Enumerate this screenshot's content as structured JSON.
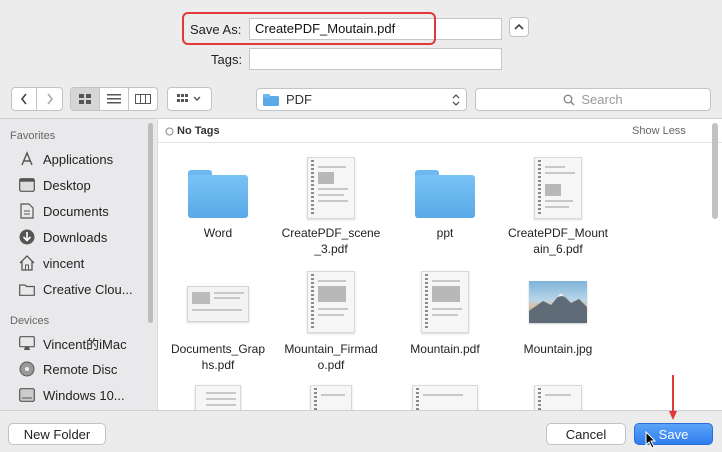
{
  "header": {
    "save_as_label": "Save As:",
    "save_as_value": "CreatePDF_Moutain.pdf",
    "tags_label": "Tags:",
    "tags_value": ""
  },
  "toolbar": {
    "location": "PDF",
    "search_placeholder": "Search"
  },
  "sidebar": {
    "favorites_heading": "Favorites",
    "favorites": [
      "Applications",
      "Desktop",
      "Documents",
      "Downloads",
      "vincent",
      "Creative Clou..."
    ],
    "devices_heading": "Devices",
    "devices": [
      "Vincent的iMac",
      "Remote Disc",
      "Windows 10..."
    ]
  },
  "browser": {
    "tag_label": "No Tags",
    "show_less": "Show Less",
    "items": [
      {
        "name": "Word",
        "kind": "folder"
      },
      {
        "name": "CreatePDF_scene_3.pdf",
        "kind": "pdf"
      },
      {
        "name": "ppt",
        "kind": "folder"
      },
      {
        "name": "CreatePDF_Mountain_6.pdf",
        "kind": "pdf"
      },
      {
        "name": "Documents_Graphs.pdf",
        "kind": "wide-pdf"
      },
      {
        "name": "Mountain_Firmado.pdf",
        "kind": "pdf"
      },
      {
        "name": "Mountain.pdf",
        "kind": "pdf"
      },
      {
        "name": "Mountain.jpg",
        "kind": "image"
      }
    ],
    "row1_names": [
      "Word",
      "CreatePDF_scene\n_3.pdf",
      "ppt",
      "CreatePDF_Mount\nain_6.pdf"
    ],
    "row2_names": [
      "Documents_Grap\nhs.pdf",
      "Mountain_Firmad\no.pdf",
      "Mountain.pdf",
      "Mountain.jpg"
    ]
  },
  "footer": {
    "new_folder": "New Folder",
    "cancel": "Cancel",
    "save": "Save"
  },
  "colors": {
    "highlight": "#e0383b",
    "primary_button": "#2f7df0",
    "folder": "#6fb8ef"
  }
}
